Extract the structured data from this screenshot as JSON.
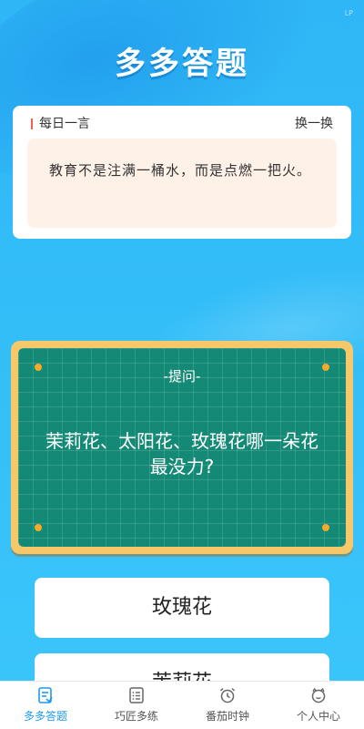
{
  "corner_mark": "LP",
  "app_title": "多多答题",
  "quote": {
    "label": "每日一言",
    "refresh": "换一换",
    "text": "教育不是注满一桶水，而是点燃一把火。"
  },
  "board": {
    "label": "-提问-",
    "question": "茉莉花、太阳花、玫瑰花哪一朵花最没力?"
  },
  "answers": [
    "玫瑰花",
    "茉莉花"
  ],
  "tabs": [
    {
      "label": "多多答题",
      "icon": "quiz-doc-icon",
      "active": true
    },
    {
      "label": "巧匠多练",
      "icon": "list-icon",
      "active": false
    },
    {
      "label": "番茄时钟",
      "icon": "alarm-clock-icon",
      "active": false
    },
    {
      "label": "个人中心",
      "icon": "smile-face-icon",
      "active": false
    }
  ],
  "colors": {
    "background": "#33bdf8",
    "accent": "#1d9bf0",
    "board": "#148a76",
    "board_frame": "#f6c86a",
    "quote_bar": "#ef5f4b"
  }
}
